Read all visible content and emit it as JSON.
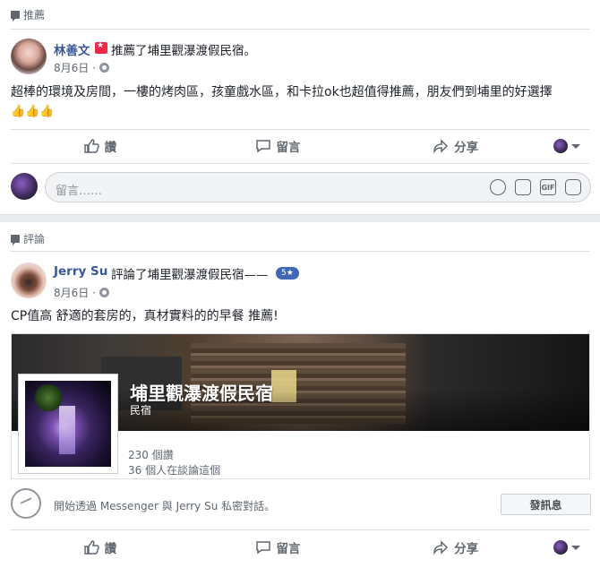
{
  "post1": {
    "section_label": "推薦",
    "author": "林善文",
    "action": "推薦了埔里觀瀑渡假民宿。",
    "date": "8月6日 ·",
    "body": "超棒的環境及房間，一樓的烤肉區，孩童戲水區，和卡拉ok也超值得推薦，朋友們到埔里的好選擇",
    "emoji": "👍👍👍",
    "like_label": "讚",
    "comment_label": "留言",
    "share_label": "分享",
    "comment_placeholder": "留言……"
  },
  "post2": {
    "section_label": "評論",
    "author": "Jerry Su",
    "action": "評論了埔里觀瀑渡假民宿——",
    "rating": "5★",
    "date": "8月6日 ·",
    "body": "CP值高 舒適的套房的，真材實料的的早餐 推薦!",
    "page_name": "埔里觀瀑渡假民宿",
    "page_category": "民宿",
    "page_likes": "230 個讚",
    "page_talking": "36 個人在談論這個",
    "messenger_text": "開始透過 Messenger 與 Jerry Su 私密對話。",
    "send_button": "發訊息",
    "like_label": "讚",
    "comment_label": "留言",
    "share_label": "分享"
  },
  "colors": {
    "link": "#385898",
    "muted": "#606770",
    "brand": "#4267b2"
  }
}
